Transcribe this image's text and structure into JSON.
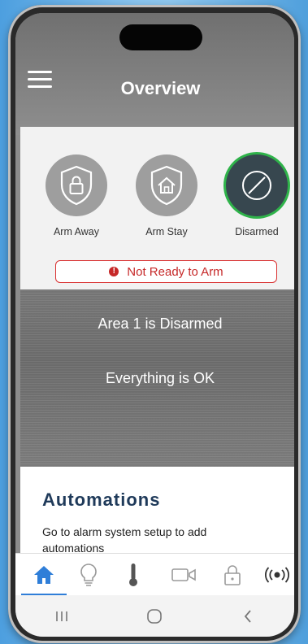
{
  "header": {
    "title": "Overview"
  },
  "modes": [
    {
      "label": "Arm Away",
      "icon": "shield-lock-icon",
      "active": false
    },
    {
      "label": "Arm Stay",
      "icon": "shield-home-icon",
      "active": false
    },
    {
      "label": "Disarmed",
      "icon": "disarmed-circle-icon",
      "active": true
    }
  ],
  "alert": {
    "icon": "error-icon",
    "icon_glyph": "!",
    "text": "Not Ready to Arm"
  },
  "status": {
    "area": "Area 1 is Disarmed",
    "message": "Everything is OK"
  },
  "automations": {
    "heading": "Automations",
    "description": "Go to alarm system setup to add automations"
  },
  "tabs": [
    {
      "icon": "home-icon",
      "active": true
    },
    {
      "icon": "lightbulb-icon",
      "active": false
    },
    {
      "icon": "thermometer-icon",
      "active": false
    },
    {
      "icon": "video-camera-icon",
      "active": false
    },
    {
      "icon": "lock-icon",
      "active": false
    },
    {
      "icon": "security-sensor-icon",
      "active": false
    }
  ],
  "system_nav": [
    {
      "icon": "recent-apps-icon"
    },
    {
      "icon": "home-circle-icon"
    },
    {
      "icon": "back-icon"
    }
  ],
  "colors": {
    "accent_blue": "#2f7ed8",
    "alert_red": "#c62828",
    "active_green": "#2fb34a",
    "heading_navy": "#1f3a5a"
  }
}
